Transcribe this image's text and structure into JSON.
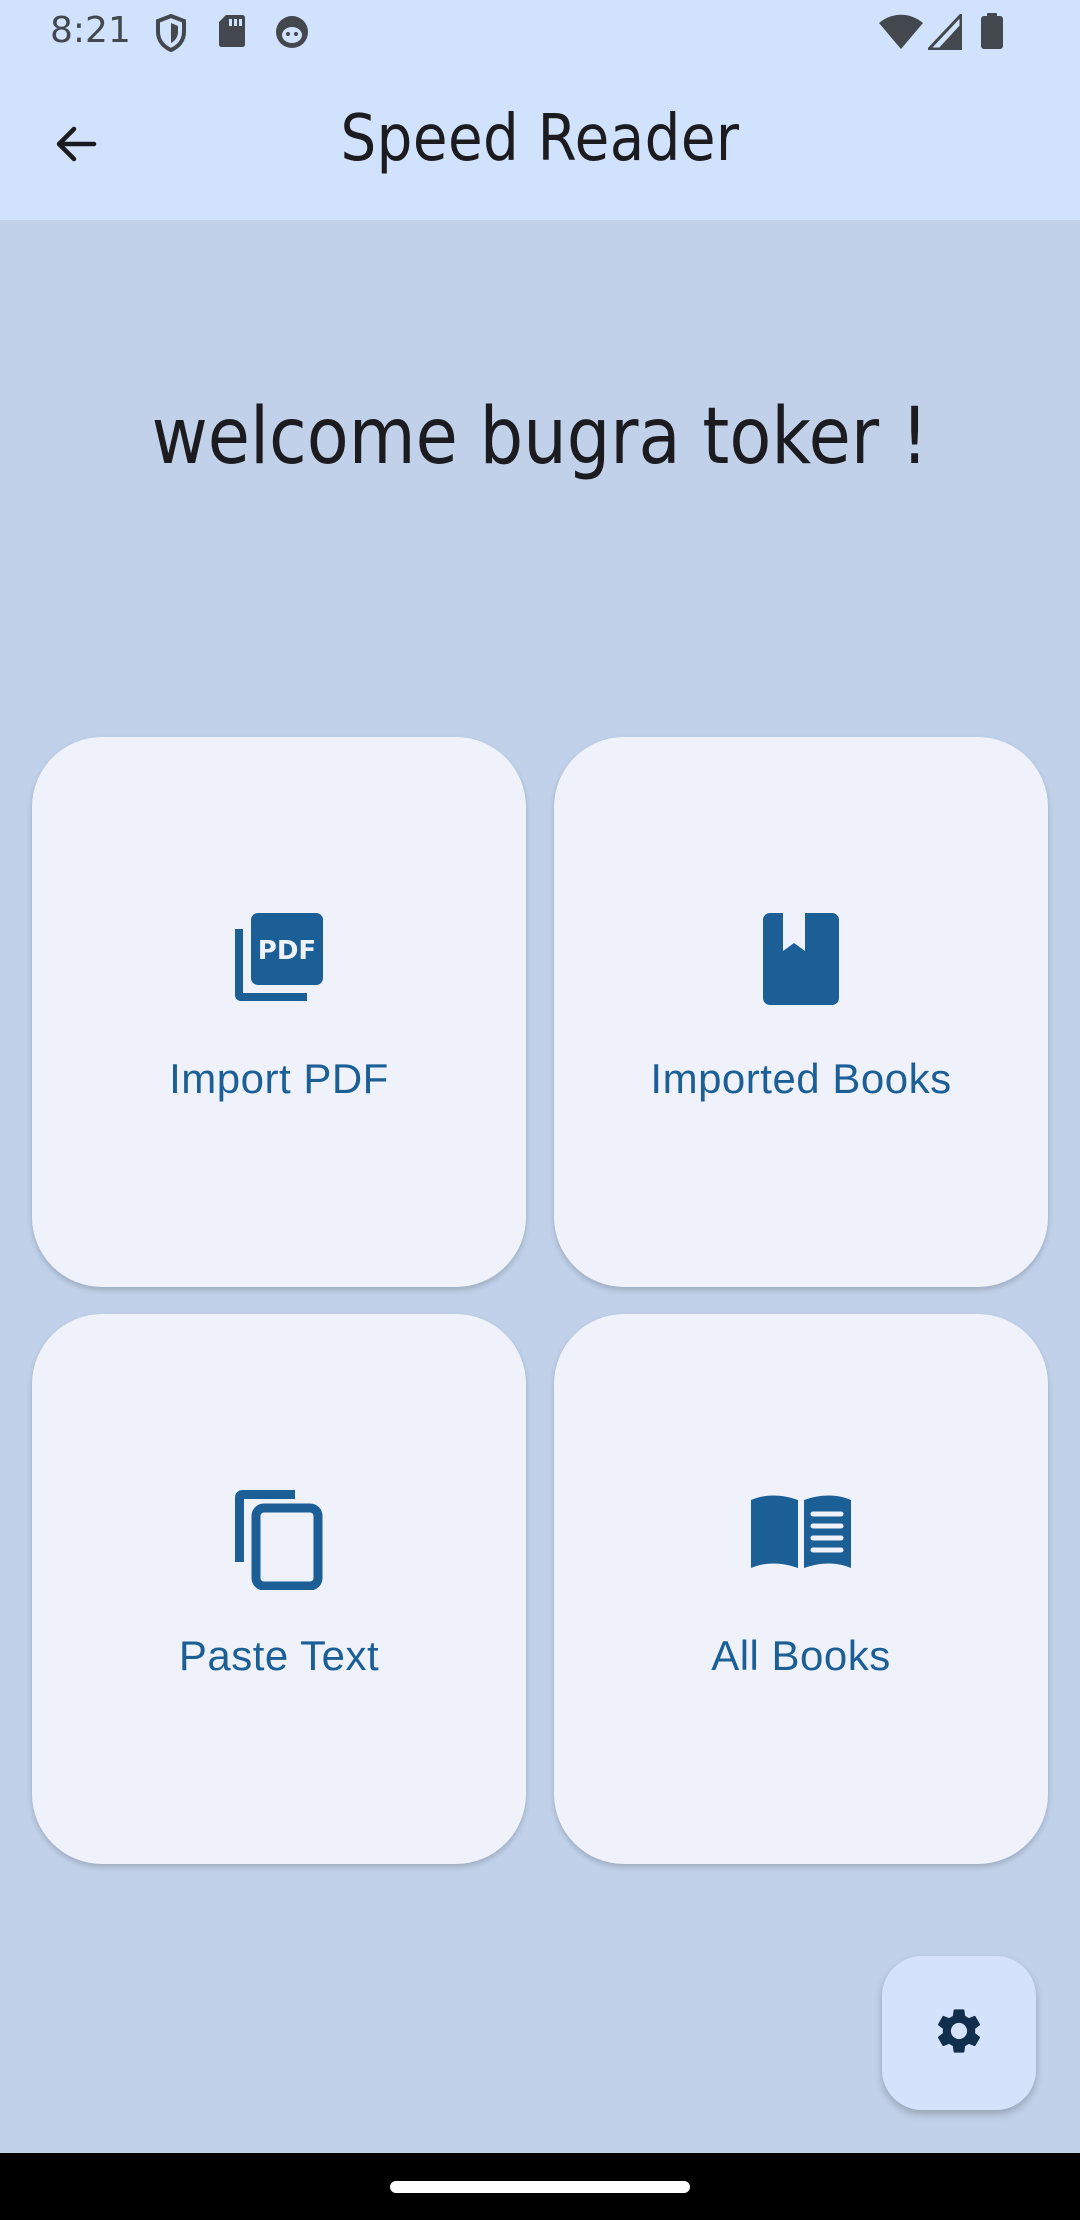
{
  "status_bar": {
    "time": "8:21",
    "left_icons": [
      "shield-icon",
      "sd-card-icon",
      "cat-face-icon"
    ],
    "right_icons": [
      "wifi-icon",
      "signal-icon",
      "battery-icon"
    ]
  },
  "app_bar": {
    "title": "Speed Reader",
    "back_icon": "arrow-left-icon"
  },
  "welcome_text": "welcome bugra toker !",
  "cards": [
    {
      "label": "Import PDF",
      "icon": "pdf-icon"
    },
    {
      "label": "Imported Books",
      "icon": "book-bookmark-icon"
    },
    {
      "label": "Paste Text",
      "icon": "copy-icon"
    },
    {
      "label": "All Books",
      "icon": "open-book-icon"
    }
  ],
  "fab": {
    "icon": "gear-icon"
  },
  "colors": {
    "background": "#c0d1e9",
    "app_bar": "#d1e2fc",
    "card": "#eff2fa",
    "accent": "#1b5f96",
    "fab": "#d4e3fb"
  }
}
